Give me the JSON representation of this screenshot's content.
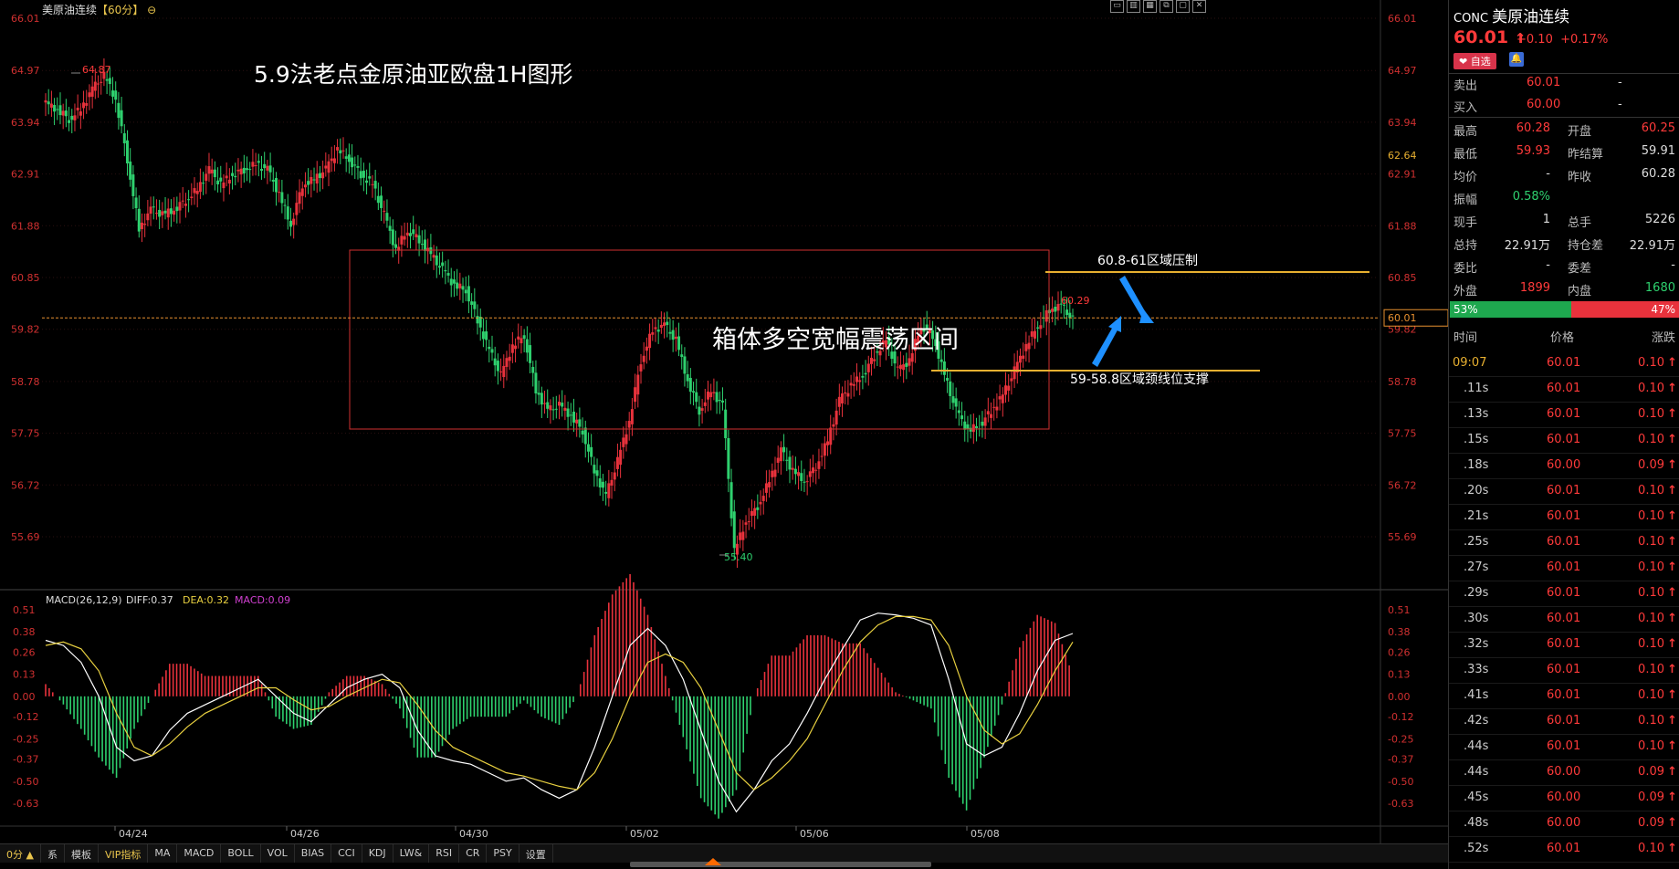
{
  "header": {
    "symbol_name": "美原油连续",
    "period": "【60分】",
    "period_icon": "⊖"
  },
  "window_icons": [
    "▭",
    "▥",
    "▦",
    "⧉",
    "▢",
    "✕"
  ],
  "annotations": {
    "title": "5.9法老点金原油亚欧盘1H图形",
    "box_label": "箱体多空宽幅震荡区间",
    "resistance": "60.8-61区域压制",
    "support": "59-58.8区域颈线位支撑",
    "high_label": "64.87",
    "low_label": "55.40",
    "last_high_label": "60.29"
  },
  "price_axis": {
    "left_labels": [
      "66.01",
      "64.97",
      "63.94",
      "62.91",
      "61.88",
      "60.85",
      "59.82",
      "58.78",
      "57.75",
      "56.72",
      "55.69"
    ],
    "right_labels": [
      "66.01",
      "64.97",
      "63.94",
      "62.91",
      "61.88",
      "60.85",
      "59.82",
      "58.78",
      "57.75",
      "56.72",
      "55.69"
    ],
    "current_price_tag": "60.01",
    "crosshair_tag": "62.64"
  },
  "macd": {
    "title": "MACD(26,12,9)",
    "diff": "DIFF:0.37",
    "dea": "DEA:0.32",
    "macd": "MACD:0.09",
    "axis_labels": [
      "0.51",
      "0.38",
      "0.26",
      "0.13",
      "0.00",
      "-0.12",
      "-0.25",
      "-0.37",
      "-0.50",
      "-0.63"
    ]
  },
  "date_labels": [
    "04/24",
    "04/26",
    "04/30",
    "05/02",
    "05/06",
    "05/08"
  ],
  "bottom_tabs": {
    "first": "0分 ▲",
    "items": [
      "系",
      "模板",
      "VIP指标",
      "MA",
      "MACD",
      "BOLL",
      "VOL",
      "BIAS",
      "CCI",
      "KDJ",
      "LW&",
      "RSI",
      "CR",
      "PSY",
      "设置"
    ]
  },
  "chart_data": {
    "type": "candlestick",
    "title": "5.9法老点金原油亚欧盘1H图形",
    "ylim": [
      55.2,
      66.1
    ],
    "categories": [
      "04/24",
      "04/26",
      "04/30",
      "05/02",
      "05/06",
      "05/08"
    ],
    "price_path": [
      64.3,
      64.2,
      64.0,
      64.2,
      64.6,
      64.87,
      64.4,
      63.2,
      61.8,
      62.2,
      62.1,
      62.2,
      62.4,
      62.6,
      63.0,
      62.7,
      62.9,
      63.0,
      63.1,
      63.0,
      62.5,
      61.9,
      62.7,
      62.8,
      63.0,
      63.4,
      63.2,
      62.9,
      62.7,
      62.1,
      61.4,
      61.8,
      61.6,
      61.3,
      61.0,
      60.7,
      60.6,
      60.0,
      59.4,
      58.9,
      59.5,
      59.7,
      58.6,
      58.2,
      58.3,
      58.1,
      57.8,
      57.0,
      56.5,
      57.2,
      58.0,
      59.2,
      59.8,
      59.9,
      59.6,
      58.8,
      58.2,
      58.6,
      58.3,
      55.4,
      56.0,
      56.3,
      56.8,
      57.4,
      57.0,
      56.8,
      57.1,
      57.6,
      58.4,
      58.7,
      58.9,
      59.3,
      59.6,
      59.0,
      59.2,
      59.9,
      59.7,
      58.9,
      58.2,
      57.8,
      57.9,
      58.2,
      58.5,
      59.0,
      59.5,
      59.9,
      60.2,
      60.29,
      60.01
    ],
    "current_price": 60.01,
    "session_high": 64.87,
    "session_low": 55.4,
    "box_range": [
      57.75,
      61.2
    ],
    "resistance_level": 60.9,
    "support_level": 59.0,
    "macd": {
      "ylim": [
        -0.72,
        0.55
      ],
      "diff": [
        0.33,
        0.3,
        0.2,
        0.0,
        -0.3,
        -0.38,
        -0.35,
        -0.2,
        -0.1,
        -0.05,
        0.0,
        0.05,
        0.1,
        0.0,
        -0.1,
        -0.15,
        -0.05,
        0.05,
        0.1,
        0.13,
        0.05,
        -0.2,
        -0.35,
        -0.38,
        -0.4,
        -0.45,
        -0.5,
        -0.48,
        -0.55,
        -0.6,
        -0.55,
        -0.3,
        0.0,
        0.3,
        0.4,
        0.3,
        0.1,
        -0.2,
        -0.5,
        -0.68,
        -0.55,
        -0.38,
        -0.28,
        -0.1,
        0.1,
        0.28,
        0.45,
        0.49,
        0.48,
        0.46,
        0.42,
        0.1,
        -0.28,
        -0.35,
        -0.3,
        -0.1,
        0.15,
        0.33,
        0.37
      ],
      "dea": [
        0.3,
        0.32,
        0.28,
        0.15,
        -0.1,
        -0.3,
        -0.35,
        -0.28,
        -0.18,
        -0.1,
        -0.05,
        0.0,
        0.05,
        0.05,
        -0.02,
        -0.08,
        -0.06,
        0.0,
        0.05,
        0.1,
        0.08,
        -0.05,
        -0.2,
        -0.3,
        -0.35,
        -0.4,
        -0.45,
        -0.47,
        -0.5,
        -0.53,
        -0.55,
        -0.45,
        -0.25,
        0.0,
        0.2,
        0.25,
        0.2,
        0.05,
        -0.2,
        -0.45,
        -0.55,
        -0.48,
        -0.38,
        -0.25,
        -0.05,
        0.15,
        0.32,
        0.42,
        0.47,
        0.47,
        0.45,
        0.3,
        0.0,
        -0.2,
        -0.28,
        -0.22,
        -0.05,
        0.15,
        0.32
      ]
    }
  },
  "panel": {
    "code": "CONC",
    "name": "美原油连续",
    "price": "60.01",
    "arrow": "↑",
    "change": "+0.10",
    "change_pct": "+0.17%",
    "fav_label": "❤ 自选",
    "bell": "🔔",
    "ask": {
      "label": "卖出",
      "price": "60.01",
      "vol": "-"
    },
    "bid": {
      "label": "买入",
      "price": "60.00",
      "vol": "-"
    },
    "stats": [
      {
        "l1": "最高",
        "v1": "60.28",
        "l2": "开盘",
        "v2": "60.25"
      },
      {
        "l1": "最低",
        "v1": "59.93",
        "l2": "昨结算",
        "v2": "59.91"
      },
      {
        "l1": "均价",
        "v1": "-",
        "l2": "昨收",
        "v2": "60.28"
      },
      {
        "l1": "振幅",
        "v1": "0.58%",
        "l2": "",
        "v2": ""
      },
      {
        "l1": "现手",
        "v1": "1",
        "l2": "总手",
        "v2": "5226"
      },
      {
        "l1": "总持",
        "v1": "22.91万",
        "l2": "持仓差",
        "v2": "22.91万"
      },
      {
        "l1": "委比",
        "v1": "-",
        "l2": "委差",
        "v2": "-"
      },
      {
        "l1": "外盘",
        "v1": "1899",
        "l2": "内盘",
        "v2": "1680"
      }
    ],
    "ratio_buy": "53%",
    "ratio_sell": "47%",
    "ticks_header": [
      "时间",
      "价格",
      "涨跌"
    ],
    "ticks": [
      {
        "t": "09:07",
        "p": "60.01",
        "c": "0.10"
      },
      {
        "t": ".11s",
        "p": "60.01",
        "c": "0.10"
      },
      {
        "t": ".13s",
        "p": "60.01",
        "c": "0.10"
      },
      {
        "t": ".15s",
        "p": "60.01",
        "c": "0.10"
      },
      {
        "t": ".18s",
        "p": "60.00",
        "c": "0.09"
      },
      {
        "t": ".20s",
        "p": "60.01",
        "c": "0.10"
      },
      {
        "t": ".21s",
        "p": "60.01",
        "c": "0.10"
      },
      {
        "t": ".25s",
        "p": "60.01",
        "c": "0.10"
      },
      {
        "t": ".27s",
        "p": "60.01",
        "c": "0.10"
      },
      {
        "t": ".29s",
        "p": "60.01",
        "c": "0.10"
      },
      {
        "t": ".30s",
        "p": "60.01",
        "c": "0.10"
      },
      {
        "t": ".32s",
        "p": "60.01",
        "c": "0.10"
      },
      {
        "t": ".33s",
        "p": "60.01",
        "c": "0.10"
      },
      {
        "t": ".41s",
        "p": "60.01",
        "c": "0.10"
      },
      {
        "t": ".42s",
        "p": "60.01",
        "c": "0.10"
      },
      {
        "t": ".44s",
        "p": "60.01",
        "c": "0.10"
      },
      {
        "t": ".44s",
        "p": "60.00",
        "c": "0.09"
      },
      {
        "t": ".45s",
        "p": "60.00",
        "c": "0.09"
      },
      {
        "t": ".48s",
        "p": "60.00",
        "c": "0.09"
      },
      {
        "t": ".52s",
        "p": "60.01",
        "c": "0.10"
      }
    ]
  }
}
